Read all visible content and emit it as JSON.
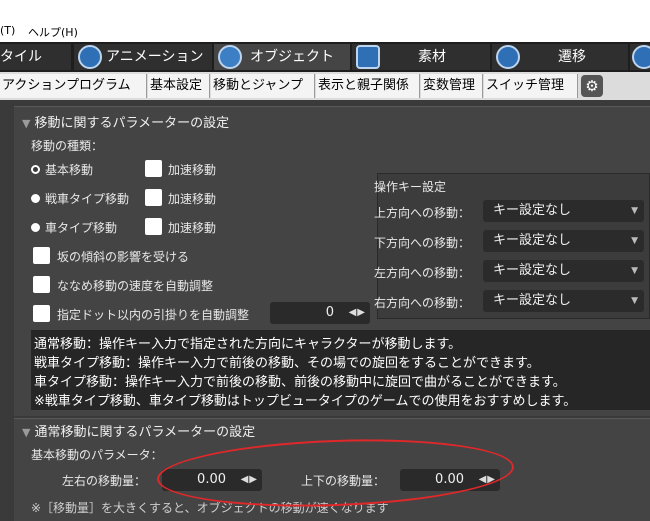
{
  "menu": {
    "items": [
      "(T)",
      "ヘルプ(H)"
    ]
  },
  "top_tabs": [
    {
      "label": "タイル",
      "icon": "tile-icon",
      "active": false
    },
    {
      "label": "アニメーション",
      "icon": "film-icon",
      "active": false
    },
    {
      "label": "オブジェクト",
      "icon": "object-jar-icon",
      "active": true
    },
    {
      "label": "素材",
      "icon": "stack-icon",
      "active": false
    },
    {
      "label": "遷移",
      "icon": "transition-icon",
      "active": false
    }
  ],
  "sub_tabs": [
    "アクションプログラム",
    "基本設定",
    "移動とジャンプ",
    "表示と親子関係",
    "変数管理",
    "スイッチ管理"
  ],
  "section1": {
    "title": "移動に関するパラメーターの設定",
    "movement_type_label": "移動の種類：",
    "radios": [
      {
        "label": "基本移動",
        "selected": false
      },
      {
        "label": "戦車タイプ移動",
        "selected": true
      },
      {
        "label": "車タイプ移動",
        "selected": true
      }
    ],
    "accel_label": "加速移動",
    "checks": [
      "坂の傾斜の影響を受ける",
      "ななめ移動の速度を自動調整",
      "指定ドット以内の引掛りを自動調整"
    ],
    "dot_value": "0",
    "keys": {
      "title": "操作キー設定",
      "rows": [
        {
          "label": "上方向への移動：",
          "value": "キー設定なし"
        },
        {
          "label": "下方向への移動：",
          "value": "キー設定なし"
        },
        {
          "label": "左方向への移動：",
          "value": "キー設定なし"
        },
        {
          "label": "右方向への移動：",
          "value": "キー設定なし"
        }
      ]
    },
    "description": [
      "通常移動：操作キー入力で指定された方向にキャラクターが移動します。",
      "戦車タイプ移動：操作キー入力で前後の移動、その場での旋回をすることができます。",
      "車タイプ移動：操作キー入力で前後の移動、前後の移動中に旋回で曲がることができます。",
      "※戦車タイプ移動、車タイプ移動はトップビュータイプのゲームでの使用をおすすめします。"
    ]
  },
  "section2": {
    "title": "通常移動に関するパラメーターの設定",
    "params_label": "基本移動のパラメータ：",
    "horizontal_label": "左右の移動量：",
    "horizontal_value": "0.00",
    "vertical_label": "上下の移動量：",
    "vertical_value": "0.00",
    "note": "※［移動量］を大きくすると、オブジェクトの移動が速くなります"
  },
  "colors": {
    "annotation": "#e0282a",
    "panel": "#444444",
    "description_bg": "#262626"
  }
}
